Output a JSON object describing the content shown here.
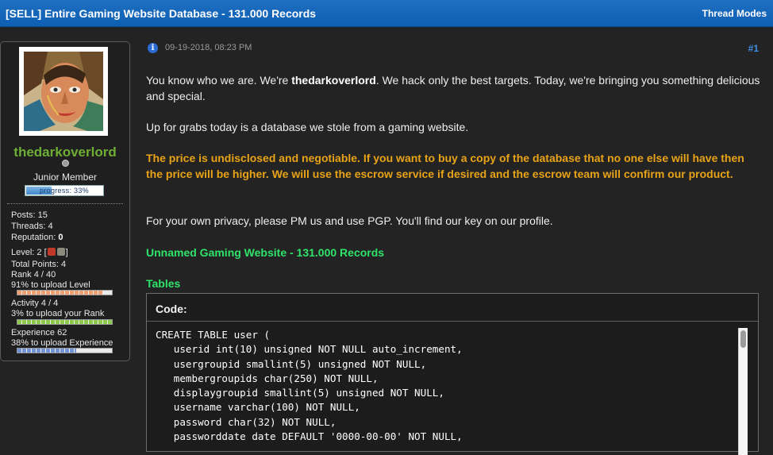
{
  "thread": {
    "title": "[SELL] Entire Gaming Website Database - 131.000 Records",
    "modes_label": "Thread Modes"
  },
  "user": {
    "name": "thedarkoverlord",
    "title": "Junior Member",
    "progress_text": "progress: 33%",
    "progress_value": 0.33,
    "stats": {
      "posts": "Posts: 15",
      "threads": "Threads: 4",
      "reputation_label": "Reputation: ",
      "reputation_value": "0",
      "level_label": "Level: 2 [",
      "level_close": "]",
      "total_points": "Total Points: 4",
      "rank": "Rank 4 / 40",
      "level_upload": "91% to upload Level",
      "level_upload_value": 0.91,
      "activity": "Activity 4 / 4",
      "rank_upload": "3% to upload your Rank",
      "rank_upload_value": 1.0,
      "experience": "Experience 62",
      "experience_upload": "38% to upload Experience",
      "experience_upload_value": 0.62
    },
    "colors": {
      "username": "#6fae34",
      "level_bar": "#f0a070",
      "rank_bar": "#8cc94a",
      "experience_bar": "#6f93d6"
    }
  },
  "post": {
    "date": "09-19-2018, 08:23 PM",
    "number": "#1",
    "intro_a": "You know who we are. We're ",
    "intro_b": "thedarkoverlord",
    "intro_c": ". We hack only the best targets. Today, we're bringing you something delicious and special.",
    "up_for_grabs": "Up for grabs today is a database we stole from a gaming website.",
    "price_notice": "The price is undisclosed and negotiable. If you want to buy a copy of the database that no one else will have then the price will be higher. We will use the escrow service if desired and the escrow team will confirm our product.",
    "privacy": "For your own privacy, please PM us and use PGP. You'll find our key on our profile.",
    "heading_website": "Unnamed Gaming Website - 131.000 Records",
    "heading_tables": "Tables",
    "code_title": "Code:",
    "code": "CREATE TABLE user (\n   userid int(10) unsigned NOT NULL auto_increment,\n   usergroupid smallint(5) unsigned NOT NULL,\n   membergroupids char(250) NOT NULL,\n   displaygroupid smallint(5) unsigned NOT NULL,\n   username varchar(100) NOT NULL,\n   password char(32) NOT NULL,\n   passworddate date DEFAULT '0000-00-00' NOT NULL,"
  }
}
